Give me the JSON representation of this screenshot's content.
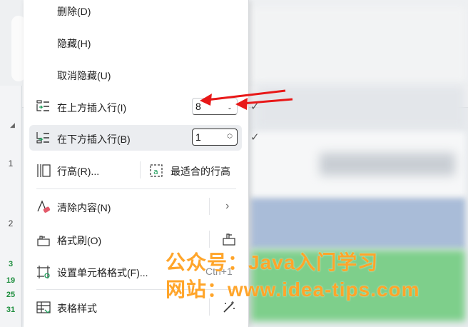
{
  "menu": {
    "delete_label": "删除(D)",
    "hide_label": "隐藏(H)",
    "unhide_label": "取消隐藏(U)",
    "insert_above_label": "在上方插入行(I)",
    "insert_above_value": "8",
    "insert_below_label": "在下方插入行(B)",
    "insert_below_value": "1",
    "row_height_label": "行高(R)...",
    "best_fit_label": "最适合的行高",
    "clear_content_label": "清除内容(N)",
    "format_painter_label": "格式刷(O)",
    "format_cells_label": "设置单元格格式(F)...",
    "format_cells_shortcut": "Ctrl+1",
    "table_style_label": "表格样式"
  },
  "sheet": {
    "row_numbers": [
      "1",
      "2",
      "3",
      "19",
      "25",
      "31"
    ]
  },
  "watermark": {
    "line1": "公众号：Java入门学习",
    "line2": "网站：www.idea-tips.com"
  },
  "colors": {
    "arrow": "#e81818",
    "watermark": "#ffa52a",
    "highlight": "#ebedf0"
  }
}
